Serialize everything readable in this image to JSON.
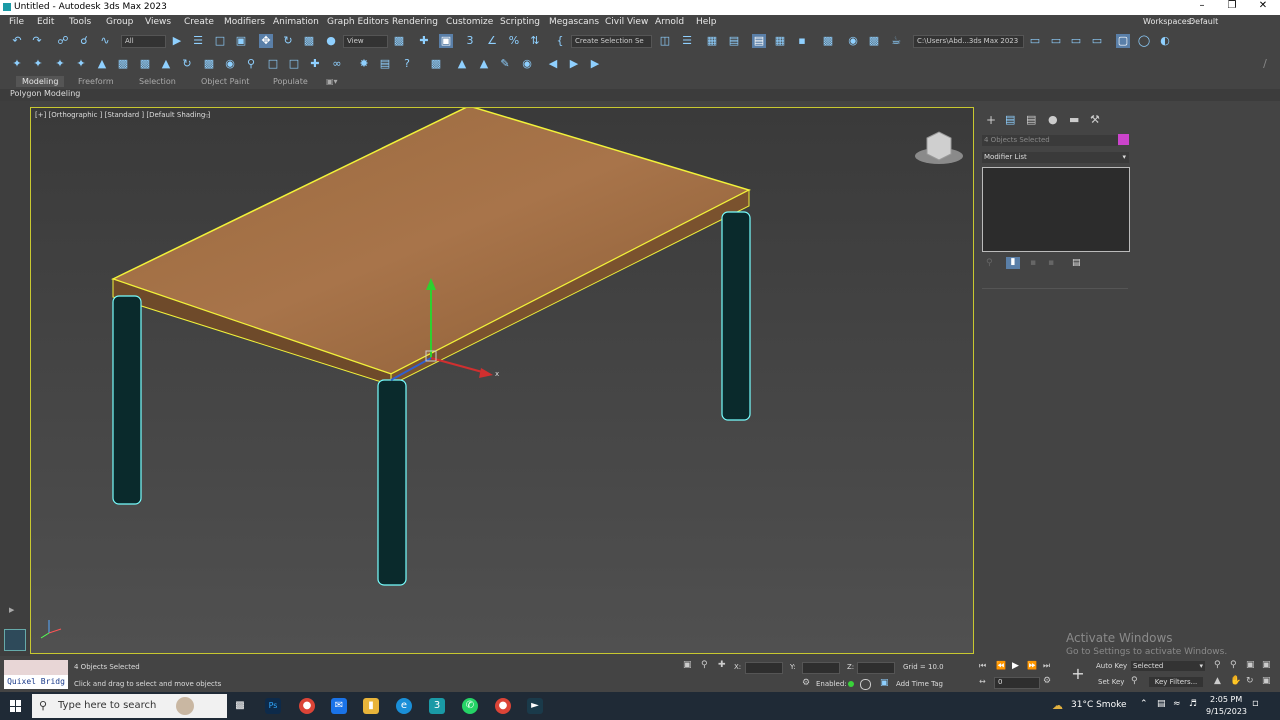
{
  "window": {
    "title": "Untitled - Autodesk 3ds Max 2023",
    "workspaces_label": "Workspaces:",
    "workspace_value": "Default"
  },
  "menu": [
    "File",
    "Edit",
    "Tools",
    "Group",
    "Views",
    "Create",
    "Modifiers",
    "Animation",
    "Graph Editors",
    "Rendering",
    "Customize",
    "Scripting",
    "Megascans",
    "Civil View",
    "Arnold",
    "Help"
  ],
  "toolbar": {
    "filter_value": "All",
    "view_value": "View",
    "selection_set": "Create Selection Se",
    "project_path": "C:\\Users\\Abd...3ds Max 2023"
  },
  "ribbon": {
    "tabs": [
      "Modeling",
      "Freeform",
      "Selection",
      "Object Paint",
      "Populate"
    ],
    "active": "Modeling",
    "sub": "Polygon Modeling"
  },
  "viewport": {
    "label": "[+] [Orthographic ] [Standard ] [Default Shading ]",
    "axis_x": "x"
  },
  "command_panel": {
    "objects_selected": "4 Objects Selected",
    "modifier_list": "Modifier List",
    "color": "#cc44cc"
  },
  "status": {
    "selected_count": "4 Objects Selected",
    "prompt": "Click and drag to select and move objects",
    "quixel": "Quixel Bridg",
    "x_label": "X:",
    "y_label": "Y:",
    "z_label": "Z:",
    "grid": "Grid = 10.0",
    "enabled": "Enabled:",
    "add_time_tag": "Add Time Tag",
    "auto_key": "Auto Key",
    "selected_value": "Selected",
    "set_key": "Set Key",
    "key_filters": "Key Filters...",
    "frame": "0"
  },
  "activation": {
    "title": "Activate Windows",
    "subtitle": "Go to Settings to activate Windows."
  },
  "taskbar": {
    "search_placeholder": "Type here to search",
    "weather": "31°C  Smoke",
    "time": "2:05 PM",
    "date": "9/15/2023"
  }
}
